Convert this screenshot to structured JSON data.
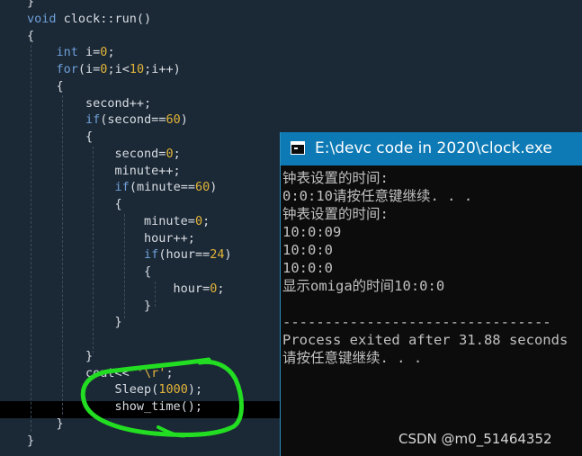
{
  "editor": {
    "lines": [
      {
        "id": "brace-close-prev",
        "parts": [
          {
            "t": "}",
            "c": "op"
          }
        ]
      },
      {
        "id": "fn-signature",
        "parts": [
          {
            "t": "void",
            "c": "kw"
          },
          {
            "t": " clock::run()",
            "c": "op"
          }
        ]
      },
      {
        "id": "brace-open-fn",
        "parts": [
          {
            "t": "{",
            "c": "op"
          }
        ]
      },
      {
        "id": "int-decl",
        "parts": [
          {
            "t": "    ",
            "c": "op"
          },
          {
            "t": "int",
            "c": "kw"
          },
          {
            "t": " i=",
            "c": "op"
          },
          {
            "t": "0",
            "c": "num"
          },
          {
            "t": ";",
            "c": "op"
          }
        ]
      },
      {
        "id": "for-loop",
        "parts": [
          {
            "t": "    ",
            "c": "op"
          },
          {
            "t": "for",
            "c": "kw"
          },
          {
            "t": "(i=",
            "c": "op"
          },
          {
            "t": "0",
            "c": "num"
          },
          {
            "t": ";i<",
            "c": "op"
          },
          {
            "t": "10",
            "c": "num"
          },
          {
            "t": ";i++)",
            "c": "op"
          }
        ]
      },
      {
        "id": "brace-open-for",
        "parts": [
          {
            "t": "    {",
            "c": "op"
          }
        ]
      },
      {
        "id": "second-inc",
        "parts": [
          {
            "t": "        second++;",
            "c": "op"
          }
        ]
      },
      {
        "id": "if-second",
        "parts": [
          {
            "t": "        ",
            "c": "op"
          },
          {
            "t": "if",
            "c": "kw"
          },
          {
            "t": "(second==",
            "c": "op"
          },
          {
            "t": "60",
            "c": "num"
          },
          {
            "t": ")",
            "c": "op"
          }
        ]
      },
      {
        "id": "brace-open-if-second",
        "parts": [
          {
            "t": "        {",
            "c": "op"
          }
        ]
      },
      {
        "id": "second-reset",
        "parts": [
          {
            "t": "            second=",
            "c": "op"
          },
          {
            "t": "0",
            "c": "num"
          },
          {
            "t": ";",
            "c": "op"
          }
        ]
      },
      {
        "id": "minute-inc",
        "parts": [
          {
            "t": "            minute++;",
            "c": "op"
          }
        ]
      },
      {
        "id": "if-minute",
        "parts": [
          {
            "t": "            ",
            "c": "op"
          },
          {
            "t": "if",
            "c": "kw"
          },
          {
            "t": "(minute==",
            "c": "op"
          },
          {
            "t": "60",
            "c": "num"
          },
          {
            "t": ")",
            "c": "op"
          }
        ]
      },
      {
        "id": "brace-open-if-minute",
        "parts": [
          {
            "t": "            {",
            "c": "op"
          }
        ]
      },
      {
        "id": "minute-reset",
        "parts": [
          {
            "t": "                minute=",
            "c": "op"
          },
          {
            "t": "0",
            "c": "num"
          },
          {
            "t": ";",
            "c": "op"
          }
        ]
      },
      {
        "id": "hour-inc",
        "parts": [
          {
            "t": "                hour++;",
            "c": "op"
          }
        ]
      },
      {
        "id": "if-hour",
        "parts": [
          {
            "t": "                ",
            "c": "op"
          },
          {
            "t": "if",
            "c": "kw"
          },
          {
            "t": "(hour==",
            "c": "op"
          },
          {
            "t": "24",
            "c": "num"
          },
          {
            "t": ")",
            "c": "op"
          }
        ]
      },
      {
        "id": "brace-open-if-hour",
        "parts": [
          {
            "t": "                {",
            "c": "op"
          }
        ]
      },
      {
        "id": "hour-reset",
        "parts": [
          {
            "t": "                    hour=",
            "c": "op"
          },
          {
            "t": "0",
            "c": "num"
          },
          {
            "t": ";",
            "c": "op"
          }
        ]
      },
      {
        "id": "brace-close-if-hour",
        "parts": [
          {
            "t": "                }",
            "c": "op"
          }
        ]
      },
      {
        "id": "brace-close-if-minute",
        "parts": [
          {
            "t": "            }",
            "c": "op"
          }
        ]
      },
      {
        "id": "blank-line",
        "parts": [
          {
            "t": "",
            "c": "op"
          }
        ]
      },
      {
        "id": "brace-close-if-second",
        "parts": [
          {
            "t": "        }",
            "c": "op"
          }
        ]
      },
      {
        "id": "cout-line",
        "parts": [
          {
            "t": "        cout<< ",
            "c": "op"
          },
          {
            "t": "'\\r'",
            "c": "num"
          },
          {
            "t": ";",
            "c": "op"
          }
        ]
      },
      {
        "id": "sleep-call",
        "parts": [
          {
            "t": "            Sleep(",
            "c": "op"
          },
          {
            "t": "1000",
            "c": "num"
          },
          {
            "t": ");",
            "c": "op"
          }
        ]
      },
      {
        "id": "show-time-call",
        "parts": [
          {
            "t": "            show_time();",
            "c": "op"
          }
        ]
      },
      {
        "id": "brace-close-for",
        "parts": [
          {
            "t": "    }",
            "c": "op"
          }
        ]
      },
      {
        "id": "brace-close-fn",
        "parts": [
          {
            "t": "}",
            "c": "op"
          }
        ]
      }
    ]
  },
  "console": {
    "title": "E:\\devc code in 2020\\clock.exe",
    "output": [
      "钟表设置的时间:",
      "0:0:10请按任意键继续. . .",
      "钟表设置的时间:",
      "10:0:09",
      "10:0:0",
      "10:0:0",
      "显示omiga的时间10:0:0",
      "",
      "--------------------------------",
      "Process exited after 31.88 seconds",
      "请按任意键继续. . ."
    ]
  },
  "watermark": "CSDN @m0_51464352",
  "colors": {
    "editor_bg": "#1b2836",
    "keyword": "#6ea0d8",
    "number": "#e2b53a",
    "console_title_bg": "#0e7ab5",
    "annotation_green": "#22dd22"
  }
}
